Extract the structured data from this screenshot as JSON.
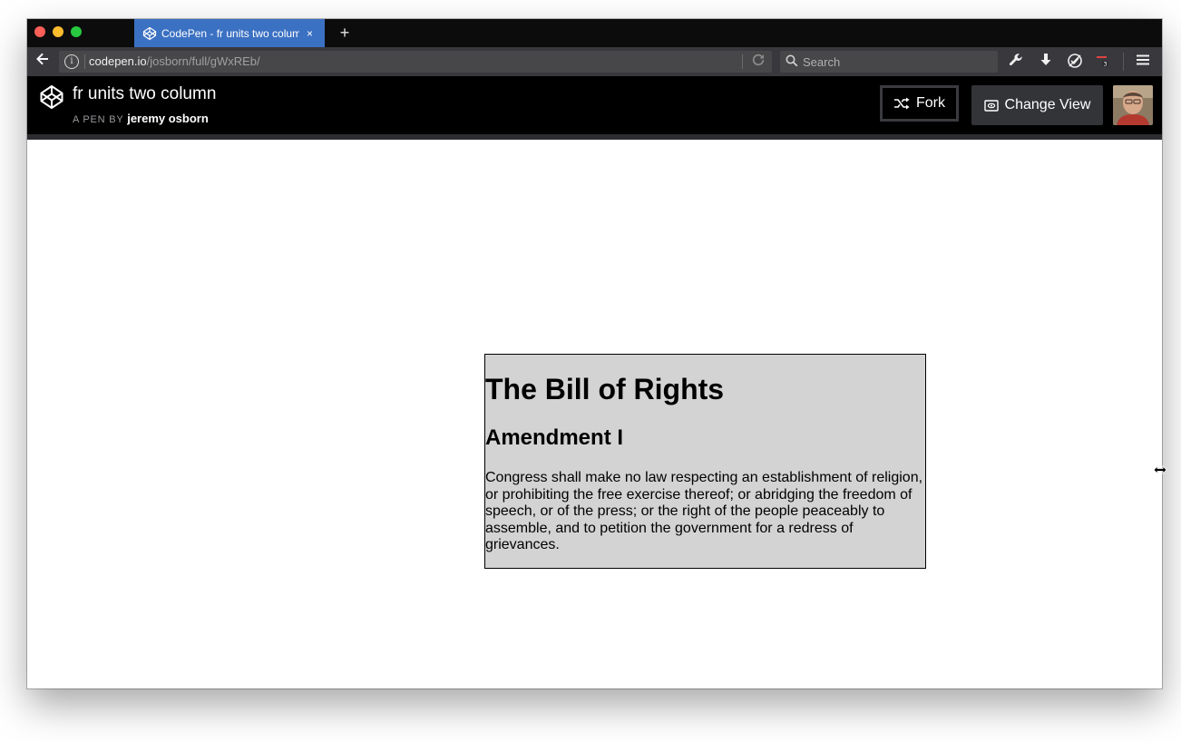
{
  "browser": {
    "tab_title": "CodePen - fr units two column",
    "tab_close": "×",
    "new_tab": "+",
    "url_host": "codepen.io",
    "url_path": "/josborn/full/gWxREb/",
    "search_placeholder": "Search",
    "icons": [
      "back-arrow-icon",
      "info-icon",
      "reload-icon",
      "search-icon",
      "wrench-icon",
      "download-icon",
      "tracking-blocked-icon",
      "extension-badge-icon",
      "hamburger-menu-icon"
    ]
  },
  "codepen": {
    "pen_title": "fr units two column",
    "by_label": "A PEN BY",
    "author": "jeremy osborn",
    "fork_label": "Fork",
    "change_view_label": "Change View"
  },
  "content": {
    "heading": "The Bill of Rights",
    "subheading": "Amendment I",
    "paragraph": "Congress shall make no law respecting an establishment of religion, or prohibiting the free exercise thereof; or abridging the freedom of speech, or of the press; or the right of the people peaceably to assemble, and to petition the government for a redress of grievances."
  },
  "colors": {
    "active_tab": "#3b71c3",
    "card_background": "#d3d3d3",
    "header_background": "#000000"
  }
}
